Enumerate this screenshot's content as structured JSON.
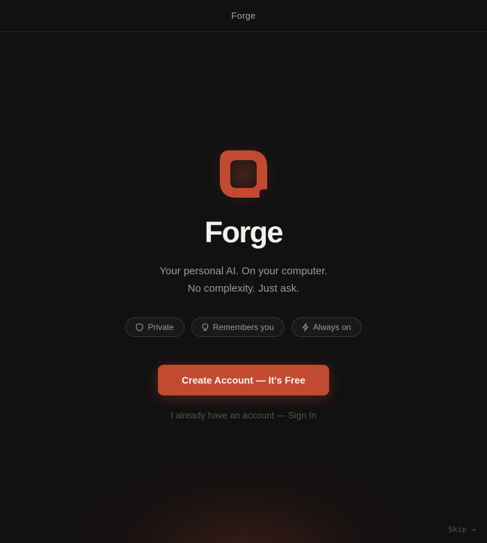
{
  "window": {
    "title": "Forge"
  },
  "hero": {
    "logo_icon": "forge-logo-icon",
    "brand_name": "Forge",
    "tagline_line1": "Your personal AI. On your computer.",
    "tagline_line2": "No complexity. Just ask."
  },
  "features": [
    {
      "label": "Private",
      "icon": "shield-icon"
    },
    {
      "label": "Remembers you",
      "icon": "lightbulb-icon"
    },
    {
      "label": "Always on",
      "icon": "lightning-icon"
    }
  ],
  "actions": {
    "create_account_label": "Create Account — It's Free",
    "sign_in_label": "I already have an account — Sign In",
    "skip_label": "Skip →"
  },
  "colors": {
    "background": "#121111",
    "accent": "#c24a31",
    "text_primary": "#f3f0ec",
    "text_muted": "#9d9893"
  }
}
